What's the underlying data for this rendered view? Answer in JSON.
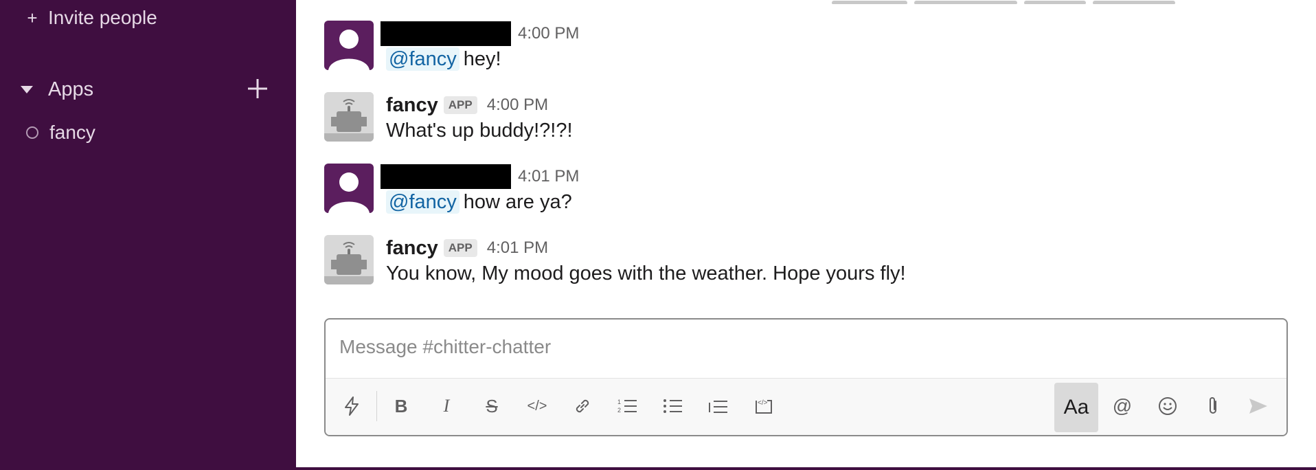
{
  "sidebar": {
    "invite_label": "Invite people",
    "apps_section_label": "Apps",
    "apps": [
      {
        "label": "fancy"
      }
    ]
  },
  "messages": [
    {
      "author_redacted": true,
      "time": "4:00 PM",
      "mention": "@fancy",
      "text": "hey!"
    },
    {
      "author": "fancy",
      "badge": "APP",
      "time": "4:00 PM",
      "text": "What's up buddy!?!?!"
    },
    {
      "author_redacted": true,
      "time": "4:01 PM",
      "mention": "@fancy",
      "text": "how are ya?"
    },
    {
      "author": "fancy",
      "badge": "APP",
      "time": "4:01 PM",
      "text": "You know, My mood goes with the weather. Hope yours fly!"
    }
  ],
  "composer": {
    "placeholder": "Message #chitter-chatter",
    "format_toggle_label": "Aa"
  },
  "colors": {
    "sidebar": "#3f0e40",
    "mention": "#1264a3",
    "mention_bg": "#e8f5fa"
  }
}
